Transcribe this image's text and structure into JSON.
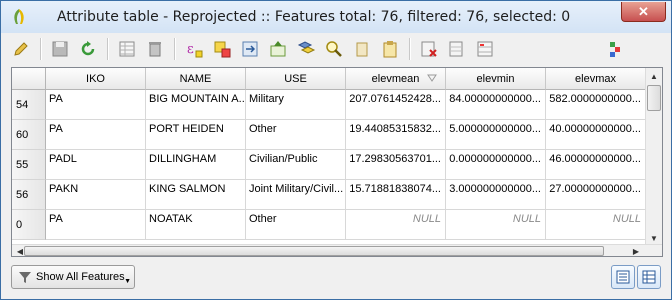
{
  "window": {
    "title": "Attribute table - Reprojected :: Features total: 76, filtered: 76, selected: 0",
    "close_label": "✕"
  },
  "toolbar": {
    "buttons": [
      {
        "name": "toggle-editing-icon"
      },
      {
        "name": "save-edits-icon"
      },
      {
        "name": "reload-icon"
      },
      {
        "name": "add-feature-icon"
      },
      {
        "name": "delete-selected-icon"
      },
      {
        "name": "select-by-expression-icon"
      },
      {
        "name": "select-all-icon"
      },
      {
        "name": "invert-selection-icon"
      },
      {
        "name": "move-selection-to-top-icon"
      },
      {
        "name": "deselect-all-icon"
      },
      {
        "name": "filter-select-icon"
      },
      {
        "name": "zoom-to-selection-icon"
      },
      {
        "name": "pan-to-selection-icon"
      },
      {
        "name": "copy-selected-rows-icon"
      },
      {
        "name": "paste-features-icon"
      },
      {
        "name": "delete-field-icon"
      },
      {
        "name": "new-field-icon"
      },
      {
        "name": "field-calculator-icon"
      },
      {
        "name": "conditional-formatting-icon"
      }
    ]
  },
  "table": {
    "columns": [
      "IKO",
      "NAME",
      "USE",
      "elevmean",
      "elevmin",
      "elevmax"
    ],
    "rows": [
      {
        "id": "54",
        "cells": [
          "PA",
          "BIG MOUNTAIN A...",
          "Military",
          "207.0761452428...",
          "84.00000000000...",
          "582.0000000000..."
        ]
      },
      {
        "id": "60",
        "cells": [
          "PA",
          "PORT HEIDEN",
          "Other",
          "19.44085315832...",
          "5.000000000000...",
          "40.00000000000..."
        ]
      },
      {
        "id": "55",
        "cells": [
          "PADL",
          "DILLINGHAM",
          "Civilian/Public",
          "17.29830563701...",
          "0.000000000000...",
          "46.00000000000..."
        ]
      },
      {
        "id": "56",
        "cells": [
          "PAKN",
          "KING SALMON",
          "Joint Military/Civil...",
          "15.71881838074...",
          "3.000000000000...",
          "27.00000000000..."
        ]
      },
      {
        "id": "0",
        "cells": [
          "PA",
          "NOATAK",
          "Other",
          "NULL",
          "NULL",
          "NULL"
        ]
      }
    ]
  },
  "footer": {
    "show_features_label": "Show All Features"
  },
  "colors": {
    "title_gradient_top": "#e7f0fb",
    "close_red": "#c75050",
    "null_text": "#8a8a8a"
  }
}
